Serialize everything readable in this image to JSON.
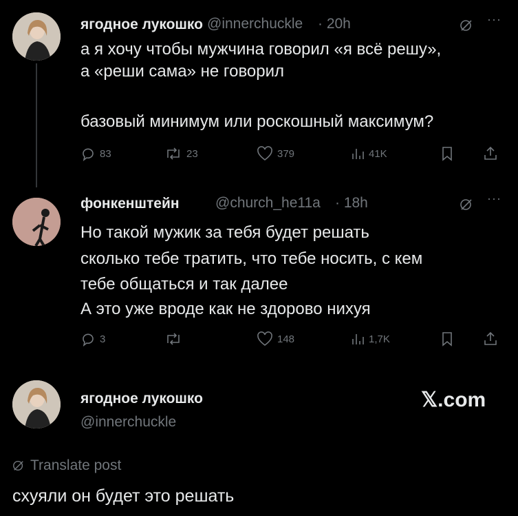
{
  "tweet1": {
    "name": "ягодное лукошко",
    "handle": "@innerchuckle",
    "time": "· 20h",
    "lines": [
      "а я хочу чтобы мужчина говорил «я всё решу»,",
      "а «реши сама» не говорил",
      "базовый минимум или роскошный максимум?"
    ],
    "replies": "83",
    "reposts": "23",
    "likes": "379",
    "views": "41K"
  },
  "tweet2": {
    "name": "фонкенштейн",
    "handle": "@church_he11a",
    "time": "· 18h",
    "lines": [
      "Но такой мужик за тебя будет решать",
      "сколько тебе тратить, что тебе носить, с кем",
      "тебе общаться и так далее",
      "А это уже вроде как не здорово нихуя"
    ],
    "replies": "3",
    "reposts": "",
    "likes": "148",
    "views": "1,7K"
  },
  "tweet3": {
    "name": "ягодное лукошко",
    "handle": "@innerchuckle",
    "brand": "𝕏.com",
    "translate": "Translate post",
    "text": "схуяли он будет это решать"
  },
  "colors": {
    "background": "#000000",
    "text": "#e7e9ea",
    "muted": "#71767b",
    "link": "#1d9bf0"
  }
}
